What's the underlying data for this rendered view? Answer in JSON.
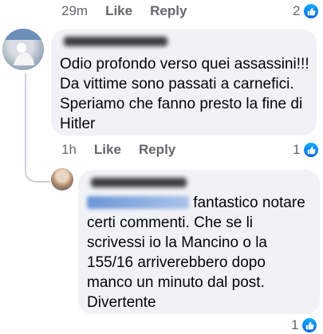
{
  "top_row": {
    "time": "29m",
    "like": "Like",
    "reply": "Reply",
    "reactions": "2"
  },
  "comment": {
    "text_lines": [
      "Odio profondo verso quei assassini!!!",
      "Da vittime sono passati a carnefici.",
      "Speriamo che fanno presto la fine di",
      "Hitler"
    ],
    "time": "1h",
    "like": "Like",
    "reply": "Reply",
    "reactions": "1"
  },
  "reply": {
    "first_line_rest": "fantastico notare",
    "text_lines": [
      "certi commenti. Che se li",
      "scrivessi io la Mancino o la",
      "155/16 arriverebbero dopo",
      "manco un minuto dal post.",
      "Divertente"
    ],
    "reactions": "1"
  },
  "colors": {
    "bubble": "#f0f2f5",
    "meta_text": "#65676b",
    "like_blue": "#1877f2"
  },
  "icons": [
    "like-reaction-icon",
    "avatar"
  ]
}
